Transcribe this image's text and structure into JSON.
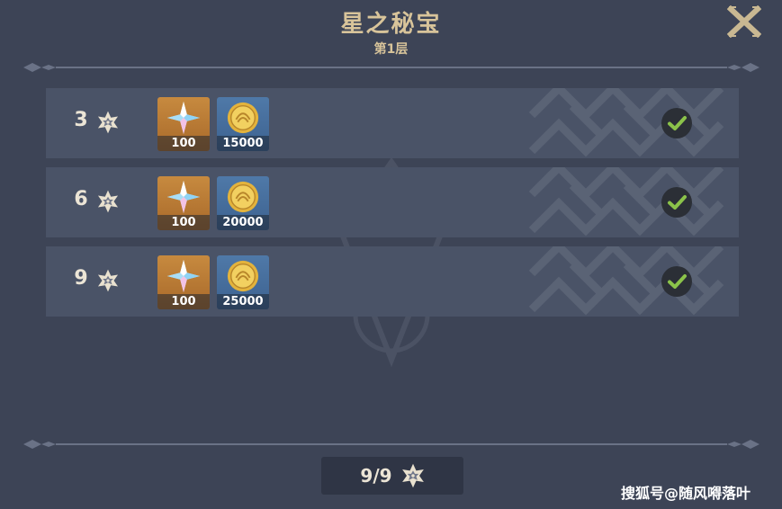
{
  "header": {
    "title": "星之秘宝",
    "subtitle": "第1层",
    "close_icon": "close-x-icon"
  },
  "rewards": [
    {
      "stars": "3",
      "items": [
        {
          "icon": "primogem-icon",
          "qty": "100"
        },
        {
          "icon": "mora-coin-icon",
          "qty": "15000"
        }
      ],
      "status_icon": "checkmark-icon",
      "claimed": true
    },
    {
      "stars": "6",
      "items": [
        {
          "icon": "primogem-icon",
          "qty": "100"
        },
        {
          "icon": "mora-coin-icon",
          "qty": "20000"
        }
      ],
      "status_icon": "checkmark-icon",
      "claimed": true
    },
    {
      "stars": "9",
      "items": [
        {
          "icon": "primogem-icon",
          "qty": "100"
        },
        {
          "icon": "mora-coin-icon",
          "qty": "25000"
        }
      ],
      "status_icon": "checkmark-icon",
      "claimed": true
    }
  ],
  "progress": {
    "text": "9/9",
    "icon": "abyss-star-icon"
  },
  "watermark": "搜狐号@随风嘚落叶",
  "colors": {
    "background": "#3d4456",
    "row": "#4a5367",
    "title": "#d8c49a",
    "check": "#8bc34a",
    "gem_card": "#c78a3f",
    "coin_card": "#4f79a8"
  }
}
